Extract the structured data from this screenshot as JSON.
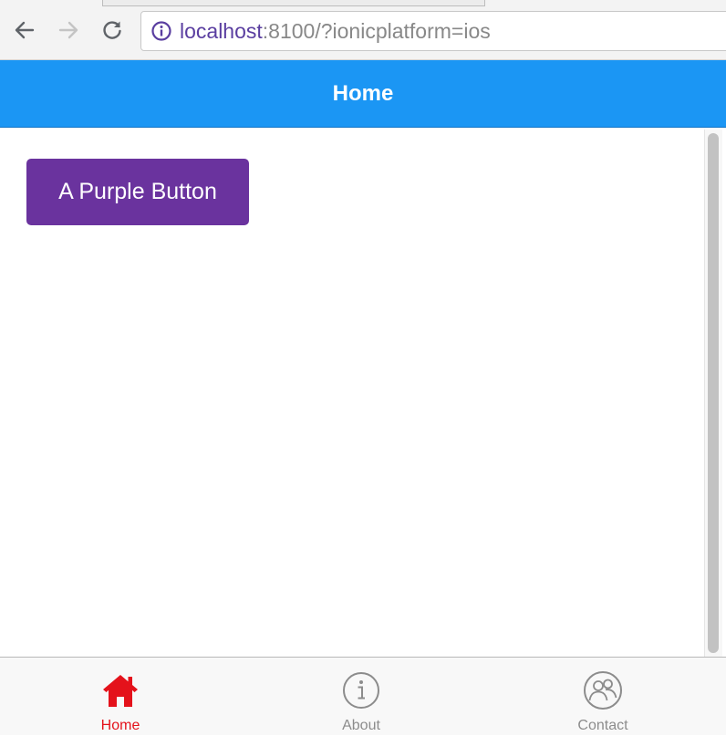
{
  "browser": {
    "url_host": "localhost",
    "url_rest": ":8100/?ionicplatform=ios",
    "icons": {
      "back": "arrow-left-icon",
      "forward": "arrow-right-icon",
      "reload": "reload-icon",
      "info": "info-icon"
    }
  },
  "header": {
    "title": "Home",
    "color": "#1b96f4"
  },
  "content": {
    "button_label": "A Purple Button",
    "button_color": "#6a339e"
  },
  "tabs": [
    {
      "label": "Home",
      "icon": "home-icon",
      "active": true,
      "color": "#e4121b"
    },
    {
      "label": "About",
      "icon": "info-circle-icon",
      "active": false,
      "color": "#8c8c8c"
    },
    {
      "label": "Contact",
      "icon": "contacts-icon",
      "active": false,
      "color": "#8c8c8c"
    }
  ]
}
